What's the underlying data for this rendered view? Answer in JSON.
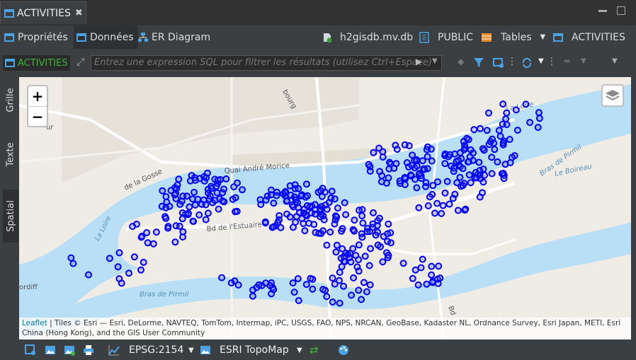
{
  "window_tab": {
    "title": "ACTIVITIES",
    "close": "✖"
  },
  "subtabs": [
    {
      "label": "Propriétés"
    },
    {
      "label": "Données"
    },
    {
      "label": "ER Diagram"
    }
  ],
  "context": {
    "database": "h2gisdb.mv.db",
    "schema": "PUBLIC",
    "type": "Tables",
    "table": "ACTIVITIES"
  },
  "filter": {
    "entity": "ACTIVITIES",
    "placeholder": "Entrez une expression SQL pour filtrer les résultats (utilisez Ctrl+Espace)"
  },
  "side_tabs": [
    {
      "label": "Grille"
    },
    {
      "label": "Texte"
    },
    {
      "label": "Spatial"
    }
  ],
  "map": {
    "zoom_in": "+",
    "zoom_out": "−",
    "labels": {
      "loire_left": "La Loire",
      "loire_right": "La Loire",
      "bras_pirmil_left": "Bras de Pirmil",
      "bras_pirmil_right": "Bras de Pirmil",
      "boireau": "Le Boireau",
      "quai": "Quai André Morice",
      "bd": "Bd de l'Estuaire",
      "gosse": "de la Gosse",
      "bourg": "bourg",
      "ur": "ur",
      "ordiff": "ordiff",
      "bd_right": "Bd"
    },
    "point_color": "#0000ff"
  },
  "attribution": {
    "leaflet": "Leaflet",
    "text": " | Tiles © Esri — Esri, DeLorme, NAVTEQ, TomTom, Intermap, iPC, USGS, FAO, NPS, NRCAN, GeoBase, Kadaster NL, Ordnance Survey, Esri Japan, METI, Esri China (Hong Kong), and the GIS User Community"
  },
  "bottom": {
    "crs": "EPSG:2154",
    "basemap": "ESRI TopoMap"
  },
  "colors": {
    "accent": "#4aa3e6",
    "water": "#b8dff5",
    "points": "#0000ff"
  }
}
